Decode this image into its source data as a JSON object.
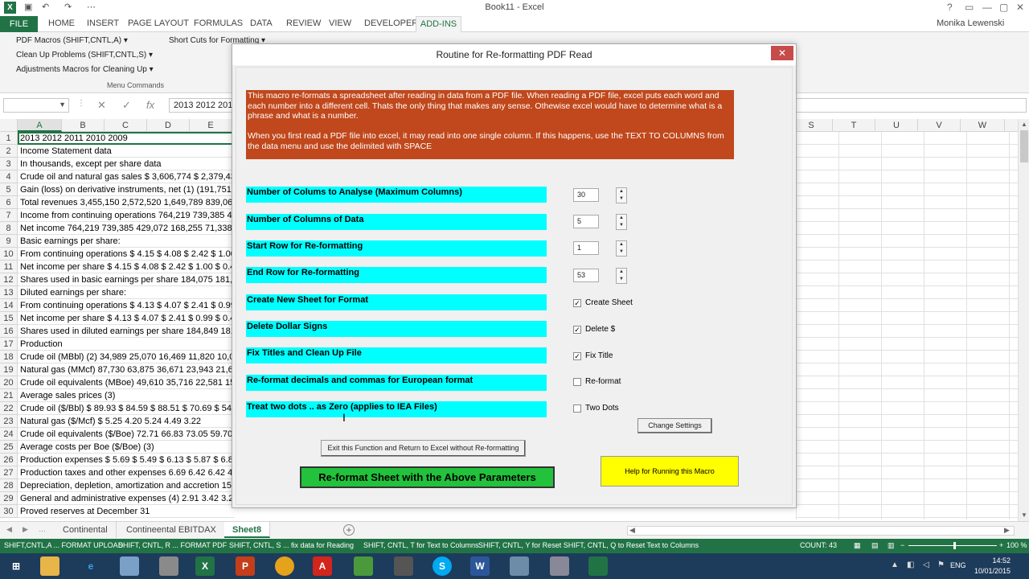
{
  "window": {
    "title": "Book11 - Excel",
    "user": "Monika Lewenski",
    "app_icon": "X",
    "controls": [
      "?",
      "▭",
      "—",
      "▢",
      "✕"
    ]
  },
  "ribbon": {
    "file": "FILE",
    "tabs": [
      "HOME",
      "INSERT",
      "PAGE LAYOUT",
      "FORMULAS",
      "DATA",
      "REVIEW",
      "VIEW",
      "DEVELOPER"
    ],
    "active_tab": "ADD-INS",
    "items": [
      "PDF Macros (SHIFT,CNTL,A) ▾",
      "Clean Up Problems (SHIFT,CNTL,S) ▾",
      "Adjustments Macros for Cleaning Up ▾",
      "Short Cuts for Formatting ▾"
    ],
    "group_label": "Menu Commands"
  },
  "formula_bar": {
    "name_box": "",
    "content": "2013 2012 201"
  },
  "grid": {
    "columns": [
      "A",
      "B",
      "C",
      "D",
      "E"
    ],
    "right_columns": [
      "S",
      "T",
      "U",
      "V",
      "W"
    ],
    "rows": [
      "2013 2012 2011 2010 2009",
      "Income Statement data",
      "In thousands, except per share data",
      "Crude oil and natural gas sales $ 3,606,774 $ 2,379,433",
      "Gain (loss) on derivative instruments, net (1) (191,751)",
      "Total revenues 3,455,150 2,572,520 1,649,789 839,065",
      "Income from continuing operations 764,219 739,385 4",
      "Net income 764,219 739,385 429,072 168,255 71,338",
      "Basic earnings per share:",
      "From continuing operations $ 4.15 $ 4.08 $ 2.42 $ 1.00",
      "Net income per share $ 4.15 $ 4.08 $ 2.42 $ 1.00 $ 0.4",
      "Shares used in basic earnings per share 184,075 181,34",
      "Diluted earnings per share:",
      "From continuing operations $ 4.13 $ 4.07 $ 2.41 $ 0.99",
      "Net income per share $ 4.13 $ 4.07 $ 2.41 $ 0.99 $ 0.4",
      "Shares used in diluted earnings per share 184,849 181,",
      "Production",
      "Crude oil (MBbl) (2) 34,989 25,070 16,469 11,820 10,02",
      "Natural gas (MMcf) 87,730 63,875 36,671 23,943 21,60",
      "Crude oil equivalents (MBoe) 49,610 35,716 22,581 15,",
      "Average sales prices (3)",
      "Crude oil ($/Bbl) $ 89.93 $ 84.59 $ 88.51 $ 70.69 $ 54.4",
      "Natural gas ($/Mcf) $ 5.25 4.20 5.24 4.49 3.22",
      "Crude oil equivalents ($/Boe) 72.71 66.83 73.05 59.70",
      "Average costs per Boe ($/Boe) (3)",
      "Production expenses $ 5.69 $ 5.49 $ 6.13 $ 5.87 $ 6.89",
      "Production taxes and other expenses 6.69 6.42 6.42 4.",
      "Depreciation, depletion, amortization and accretion 15",
      "General and administrative expenses (4) 2.91 3.42 3.23",
      "Proved reserves at December 31"
    ]
  },
  "sheets": {
    "tabs": [
      "Continental",
      "Contineental EBITDAX"
    ],
    "active": "Sheet8",
    "add": "+"
  },
  "statusbar": {
    "items": [
      "SHIFT,CNTL,A ... FORMAT UPLOAD",
      "SHIFT, CNTL, R ... FORMAT PDF",
      "SHIFT, CNTL, S ... fix data for Reading",
      "SHIFT, CNTL, T  for Text to Columns",
      "SHIFT, CNTL, Y  for Reset  SHIFT, CNTL, Q to Reset Text to Columns"
    ],
    "count": "COUNT: 43",
    "zoom": "100 %"
  },
  "taskbar": {
    "time": "14:52",
    "date": "10/01/2015",
    "lang": "ENG"
  },
  "dialog": {
    "title": "Routine for Re-formatting PDF Read",
    "close": "✕",
    "info": "This macro re-formats a spreadsheet after reading in data from a PDF file.  When reading a PDF file, excel puts each word and each number into a different cell.  Thats the only thing that makes any sense.  Othewise excel would have to determine what is a phrase and what is a number.\n\nWhen you first read a PDF file into excel, it may read into one single column.  If this happens, use the TEXT TO COLUMNS from the data menu and use the delimited with SPACE",
    "params": [
      "Number of Colums to Analyse (Maximum Columns)",
      " Number of Columns of Data",
      "Start Row for Re-formatting",
      "End Row for Re-formatting",
      "Create New Sheet for Format",
      "Delete Dollar Signs",
      "Fix Titles and Clean Up File",
      " Re-format decimals and commas for European format",
      "Treat two dots  .. as Zero (applies to IEA Files)"
    ],
    "numbers": [
      "30",
      "5",
      "1",
      "53"
    ],
    "checks": [
      {
        "label": "Create Sheet",
        "mark": "✓"
      },
      {
        "label": "Delete $",
        "mark": "✓"
      },
      {
        "label": "Fix Title",
        "mark": "✓"
      },
      {
        "label": "Re-format",
        "mark": ""
      },
      {
        "label": "Two Dots",
        "mark": ""
      }
    ],
    "change_settings": "Change Settings",
    "exit_label": "Exit this Function and Return to Excel without Re-formatting",
    "reformat_label": "Re-format Sheet with the Above Parameters",
    "help_label": "Help for Running this Macro"
  },
  "colors": {
    "excel_green": "#217346",
    "info_bg": "#c0481c",
    "param_bg": "#00ffff",
    "reformat_bg": "#22c23c",
    "help_bg": "#ffff00"
  }
}
